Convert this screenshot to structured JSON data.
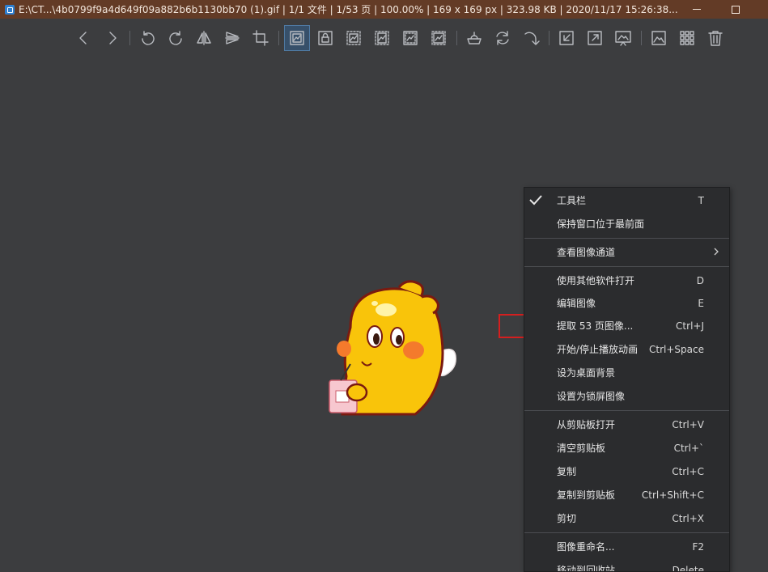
{
  "titlebar": {
    "title": "E:\\CT...\\4b0799f9a4d649f09a882b6b1130bb70 (1).gif  |  1/1 文件  |  1/53 页  |  100.00%  |  169 x 169 px  |  323.98 KB  |  2020/11/17 15:26:38..."
  },
  "toolbar": {
    "buttons": [
      {
        "name": "prev-icon"
      },
      {
        "name": "next-icon"
      },
      {
        "name": "rotate-left-icon"
      },
      {
        "name": "rotate-right-icon"
      },
      {
        "name": "flip-horizontal-icon"
      },
      {
        "name": "flip-vertical-icon"
      },
      {
        "name": "crop-icon"
      },
      {
        "name": "actual-size-icon",
        "active": true
      },
      {
        "name": "lock-zoom-icon"
      },
      {
        "name": "fit-width-icon"
      },
      {
        "name": "fit-height-icon"
      },
      {
        "name": "fit-window-icon"
      },
      {
        "name": "fill-window-icon"
      },
      {
        "name": "slideshow-icon"
      },
      {
        "name": "refresh-icon"
      },
      {
        "name": "redo-icon"
      },
      {
        "name": "open-file-icon"
      },
      {
        "name": "fullscreen-icon"
      },
      {
        "name": "frameless-icon"
      },
      {
        "name": "gallery-icon"
      },
      {
        "name": "thumbnails-icon"
      },
      {
        "name": "delete-icon"
      }
    ]
  },
  "context_menu": {
    "items": [
      {
        "label": "工具栏",
        "shortcut": "T",
        "checked": true
      },
      {
        "label": "保持窗口位于最前面",
        "shortcut": ""
      },
      {
        "separator": true
      },
      {
        "label": "查看图像通道",
        "shortcut": "",
        "submenu": true
      },
      {
        "separator": true
      },
      {
        "label": "使用其他软件打开",
        "shortcut": "D"
      },
      {
        "label": "编辑图像",
        "shortcut": "E"
      },
      {
        "label": "提取 53 页图像...",
        "shortcut": "Ctrl+J",
        "highlighted": true
      },
      {
        "label": "开始/停止播放动画",
        "shortcut": "Ctrl+Space"
      },
      {
        "label": "设为桌面背景",
        "shortcut": ""
      },
      {
        "label": "设置为锁屏图像",
        "shortcut": ""
      },
      {
        "separator": true
      },
      {
        "label": "从剪贴板打开",
        "shortcut": "Ctrl+V"
      },
      {
        "label": "清空剪贴板",
        "shortcut": "Ctrl+`"
      },
      {
        "label": "复制",
        "shortcut": "Ctrl+C"
      },
      {
        "label": "复制到剪贴板",
        "shortcut": "Ctrl+Shift+C"
      },
      {
        "label": "剪切",
        "shortcut": "Ctrl+X"
      },
      {
        "separator": true
      },
      {
        "label": "图像重命名...",
        "shortcut": "F2"
      },
      {
        "label": "移动到回收站",
        "shortcut": "Delete"
      }
    ]
  },
  "colors": {
    "titlebar_bg": "#633b26",
    "canvas_bg": "#3c3d3f",
    "menu_bg": "#2b2c2e",
    "highlight": "#d41f1f",
    "active_button": "#37506a"
  }
}
